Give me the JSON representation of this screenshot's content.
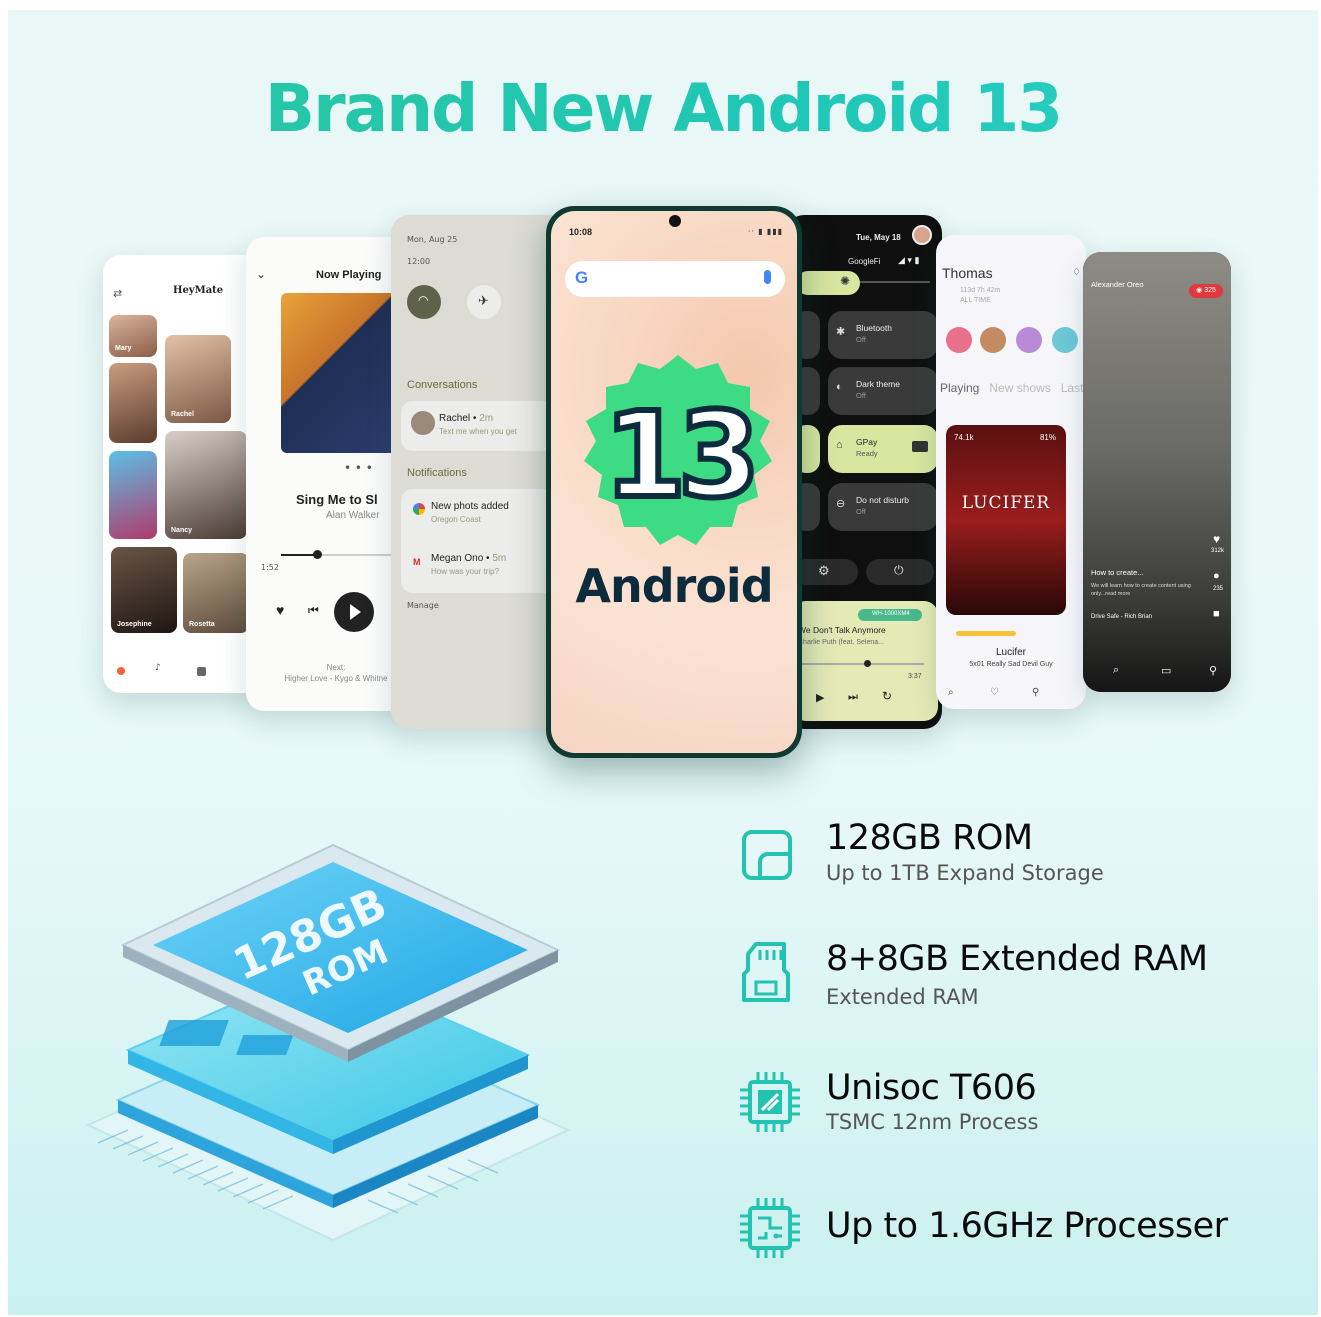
{
  "headline": "Brand New Android 13",
  "colors": {
    "accent": "#27c7a8",
    "badge_green": "#3ddc84",
    "navy": "#0c2b3d"
  },
  "phones": {
    "heymate": {
      "app_title": "HeyMate",
      "profiles": [
        "Mary",
        "Rachel",
        "Nancy",
        "Josephine",
        "Rosetta"
      ]
    },
    "music": {
      "header": "Now Playing",
      "song": "Sing Me to Sl",
      "artist": "Alan Walker",
      "elapsed": "1:52",
      "progress": 0.28,
      "next_label": "Next:",
      "next_song": "Higher Love - Kygo & Whitne"
    },
    "notifications": {
      "date": "Mon, Aug 25",
      "time": "12:00",
      "conversations_label": "Conversations",
      "conversation_name": "Rachel",
      "conversation_age": "2m",
      "conversation_msg": "Text me when you get",
      "notifications_label": "Notifications",
      "notif1_title": "New phots added",
      "notif1_msg": "Oregon Coast",
      "notif2_title": "Megan Ono",
      "notif2_age": "5m",
      "notif2_msg": "How was your trip?",
      "manage_label": "Manage"
    },
    "center": {
      "status_time": "10:08",
      "status_icons": "⋅⋅ ▮ ▮▮▮",
      "google_g": "G",
      "badge_number": "13",
      "android_word": "Android"
    },
    "quick_settings": {
      "date": "Tue, May 18",
      "network": "GoogleFi",
      "tiles": [
        {
          "title": "Bluetooth",
          "state": "Off",
          "icon": "bluetooth-icon"
        },
        {
          "title": "Dark theme",
          "state": "Off",
          "icon": "dark-theme-icon"
        },
        {
          "title": "GPay",
          "state": "Ready",
          "icon": "wallet-icon"
        },
        {
          "title": "Do not disturb",
          "state": "Off",
          "icon": "dnd-icon"
        }
      ],
      "media_device": "WH-1000XM4",
      "media_song": "We Don't Talk Anymore",
      "media_artist": "Charlie Puth (feat. Selena...",
      "media_time": "3:37"
    },
    "streaming": {
      "user": "Thomas",
      "watch_time": "113d 7h 42m",
      "watch_time_label": "ALL TIME",
      "tabs": [
        "Playing",
        "New shows",
        "Last"
      ],
      "views": "74.1k",
      "match": "81%",
      "poster_title": "LUCIFER",
      "show_title": "Lucifer",
      "episode": "5x01 Really Sad Devil Guy"
    },
    "video": {
      "author": "Alexander Oreo",
      "views": "325",
      "caption": "How to create...",
      "caption_sub": "We will learn how to create content using only...read more",
      "music": "Drive Safe - Rich Brian",
      "likes": "312k",
      "comments": "235"
    }
  },
  "chip": {
    "line1": "128GB",
    "line2": "ROM"
  },
  "specs": [
    {
      "icon": "storage-icon",
      "title": "128GB ROM",
      "subtitle": "Up to 1TB Expand Storage"
    },
    {
      "icon": "sd-card-icon",
      "title": "8+8GB Extended RAM",
      "subtitle": "Extended RAM"
    },
    {
      "icon": "processor-chip-icon",
      "title": "Unisoc T606",
      "subtitle": "TSMC 12nm Process"
    },
    {
      "icon": "circuit-chip-icon",
      "title": "Up to 1.6GHz Processer",
      "subtitle": ""
    }
  ]
}
